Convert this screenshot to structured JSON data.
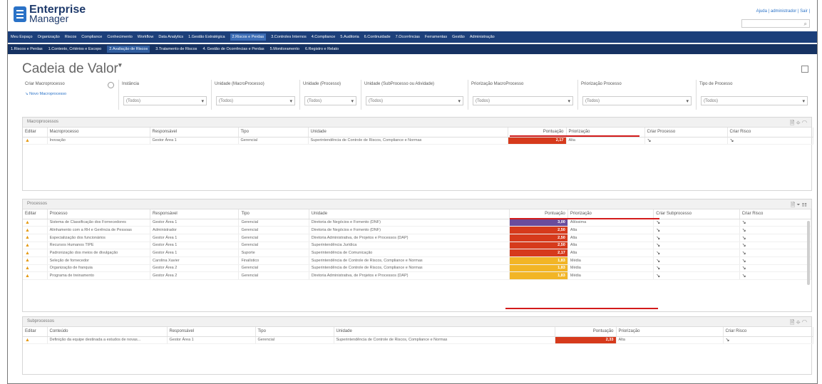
{
  "header": {
    "logo_line1": "Enterprise",
    "logo_line2": "Manager",
    "top_links": "Ajuda | administrador | Sair |"
  },
  "nav_main": [
    "Meu Espaço",
    "Organização",
    "Riscos",
    "Compliance",
    "Conhecimento",
    "Workflow",
    "Data Analytics",
    "1.Gestão Estratégica",
    "2.Riscos e Perdas",
    "3.Controles Internos",
    "4.Compliance",
    "5.Auditoria",
    "6.Continuidade",
    "7.Ocorrências",
    "Ferramentas",
    "Gestão",
    "Administração"
  ],
  "nav_main_active": 8,
  "nav_sub": [
    "1.Riscos e Perdas",
    "1.Contexto, Critérios e Escopo",
    "2.Avaliação de Riscos",
    "3.Tratamento de Riscos",
    "4. Gestão de Ocorrências e Perdas",
    "5.Monitoramento",
    "6.Registro e Relato"
  ],
  "nav_sub_active": 2,
  "page": {
    "title": "Cadeia de Valor"
  },
  "filters": {
    "criar_macro_label": "Criar Macroprocesso",
    "novo_macro_link": "Novo Macroprocesso",
    "items": [
      {
        "label": "Instância",
        "value": "(Todos)"
      },
      {
        "label": "Unidade (MacroProcesso)",
        "value": "(Todos)"
      },
      {
        "label": "Unidade (Processo)",
        "value": "(Todos)"
      },
      {
        "label": "Unidade (SubProcesso ou Atividade)",
        "value": "(Todos)"
      },
      {
        "label": "Priorização MacroProcesso",
        "value": "(Todos)"
      },
      {
        "label": "Priorização Processo",
        "value": "(Todos)"
      },
      {
        "label": "Tipo de Processo",
        "value": "(Todos)"
      }
    ]
  },
  "macro": {
    "title": "Macroprocessos",
    "columns": [
      "Editar",
      "Macroprocesso",
      "Responsável",
      "Tipo",
      "Unidade",
      "Pontuação",
      "Priorização",
      "Criar Processo",
      "Criar Risco"
    ],
    "rows": [
      {
        "name": "Inovação",
        "resp": "Gestor Área 1",
        "tipo": "Gerencial",
        "unidade": "Superintendência de Controle de Riscos, Compliance e Normas",
        "score": "2,17",
        "color": "#d63a1c",
        "prior": "Alta"
      }
    ]
  },
  "proc": {
    "title": "Processos",
    "columns": [
      "Editar",
      "Processo",
      "Responsável",
      "Tipo",
      "Unidade",
      "Pontuação",
      "Priorização",
      "Criar Subprocesso",
      "Criar Risco"
    ],
    "rows": [
      {
        "name": "Sistema de Classificação dos Fornecedores",
        "resp": "Gestor Área 1",
        "tipo": "Gerencial",
        "unidade": "Diretoria de Negócios e Fomento (DNF)",
        "score": "3,00",
        "color": "#6a4c9c",
        "prior": "Altíssima"
      },
      {
        "name": "Alinhamento com a RH e Gerência de Pessoas",
        "resp": "Administrador",
        "tipo": "Gerencial",
        "unidade": "Diretoria de Negócios e Fomento (DNF)",
        "score": "2,50",
        "color": "#d63a1c",
        "prior": "Alta"
      },
      {
        "name": "Especialização dos funcionários",
        "resp": "Gestor Área 1",
        "tipo": "Gerencial",
        "unidade": "Diretoria Administrativa, de Projetos e Processos (DAP)",
        "score": "2,50",
        "color": "#d63a1c",
        "prior": "Alta"
      },
      {
        "name": "Recursos Humanos TIPE",
        "resp": "Gestor Área 1",
        "tipo": "Gerencial",
        "unidade": "Superintendência Jurídica",
        "score": "2,50",
        "color": "#d63a1c",
        "prior": "Alta"
      },
      {
        "name": "Padronização dos meios de divulgação",
        "resp": "Gestor Área 1",
        "tipo": "Suporte",
        "unidade": "Superintendência de Comunicação",
        "score": "2,17",
        "color": "#d63a1c",
        "prior": "Alta"
      },
      {
        "name": "Seleção de fornecedor",
        "resp": "Carolina Xavier",
        "tipo": "Finalístico",
        "unidade": "Superintendência de Controle de Riscos, Compliance e Normas",
        "score": "1,83",
        "color": "#f2b526",
        "prior": "Média"
      },
      {
        "name": "Organização de franquia",
        "resp": "Gestor Área 2",
        "tipo": "Gerencial",
        "unidade": "Superintendência de Controle de Riscos, Compliance e Normas",
        "score": "1,83",
        "color": "#f2b526",
        "prior": "Média"
      },
      {
        "name": "Programa de treinamento",
        "resp": "Gestor Área 2",
        "tipo": "Gerencial",
        "unidade": "Diretoria Administrativa, de Projetos e Processos (DAP)",
        "score": "1,83",
        "color": "#f2b526",
        "prior": "Média"
      }
    ]
  },
  "sub": {
    "title": "Subprocessos",
    "columns": [
      "Editar",
      "Conteúdo",
      "Responsável",
      "Tipo",
      "Unidade",
      "Pontuação",
      "Priorização",
      "Criar Risco"
    ],
    "rows": [
      {
        "name": "Definição da equipe destinada a estudos de novas...",
        "resp": "Gestor Área 1",
        "tipo": "Gerencial",
        "unidade": "Superintendência de Controle de Riscos, Compliance e Normas",
        "score": "2,33",
        "color": "#d63a1c",
        "prior": "Alta"
      }
    ]
  }
}
